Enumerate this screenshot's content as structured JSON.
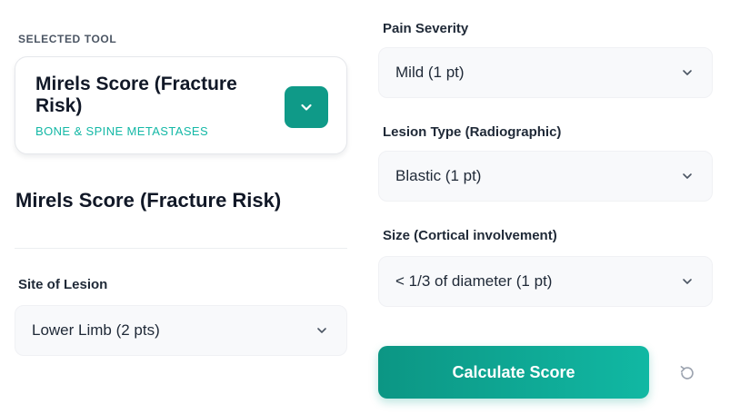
{
  "selected_tool": {
    "section_label": "SELECTED TOOL",
    "title": "Mirels Score (Fracture Risk)",
    "subtitle": "BONE & SPINE METASTASES"
  },
  "calculator": {
    "title": "Mirels Score (Fracture Risk)"
  },
  "fields": {
    "site": {
      "label": "Site of Lesion",
      "value": "Lower Limb (2 pts)"
    },
    "pain": {
      "label": "Pain Severity",
      "value": "Mild (1 pt)"
    },
    "lesion_type": {
      "label": "Lesion Type (Radiographic)",
      "value": "Blastic (1 pt)"
    },
    "size": {
      "label": "Size (Cortical involvement)",
      "value": "< 1/3 of diameter (1 pt)"
    }
  },
  "actions": {
    "calculate_label": "Calculate Score"
  },
  "icons": {
    "toggle": "chevron-down-icon",
    "select": "chevron-down-icon",
    "reset": "reset-icon"
  },
  "colors": {
    "accent": "#0f9a88",
    "accent_light": "#14b8a6"
  }
}
